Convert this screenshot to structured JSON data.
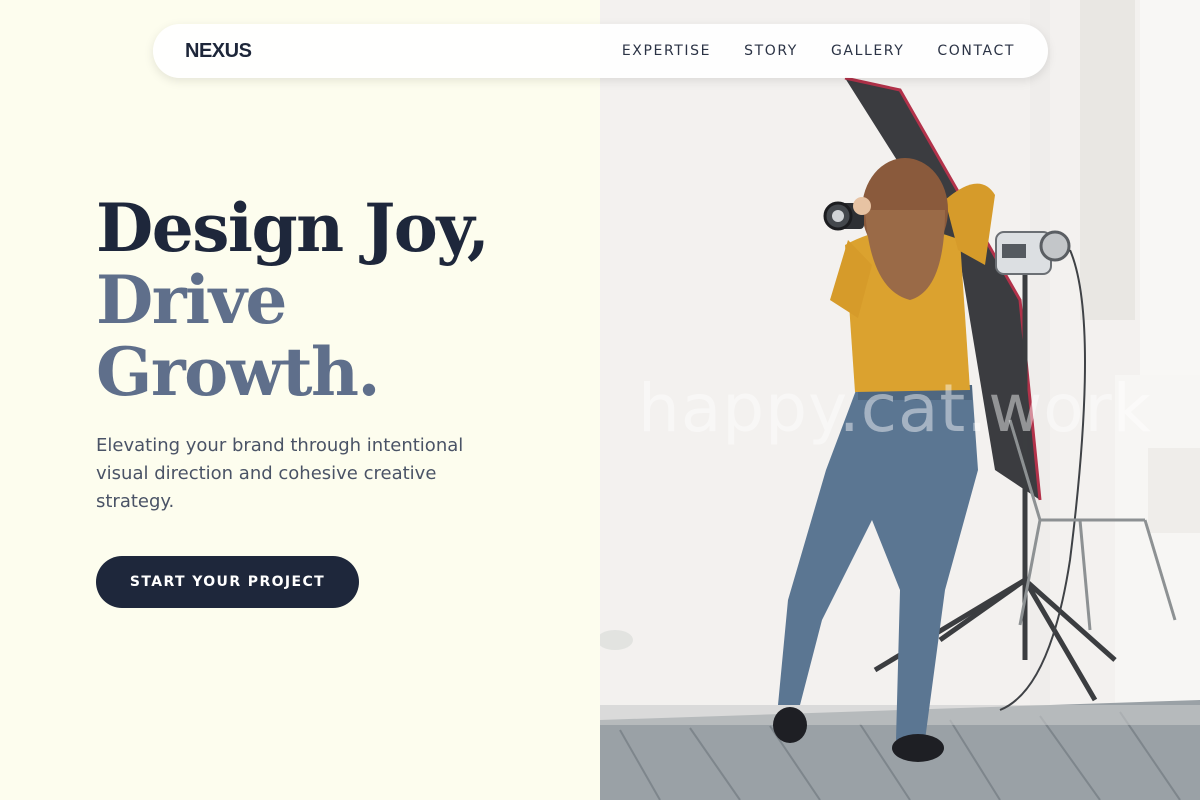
{
  "nav": {
    "brand": "NEXUS",
    "links": [
      "EXPERTISE",
      "STORY",
      "GALLERY",
      "CONTACT"
    ]
  },
  "hero": {
    "title_line1": "Design Joy,",
    "title_line2": "Drive",
    "title_line3": "Growth.",
    "subtitle": "Elevating your brand through intentional visual direction and cohesive creative strategy.",
    "cta_label": "START YOUR PROJECT"
  },
  "photo": {
    "watermark": "happy.cat.work"
  },
  "colors": {
    "background": "#fdfdee",
    "navy": "#1e273b",
    "slate": "#5f6f8b",
    "text": "#4a5366",
    "sweater": "#dba22f",
    "jeans": "#5b7692"
  }
}
